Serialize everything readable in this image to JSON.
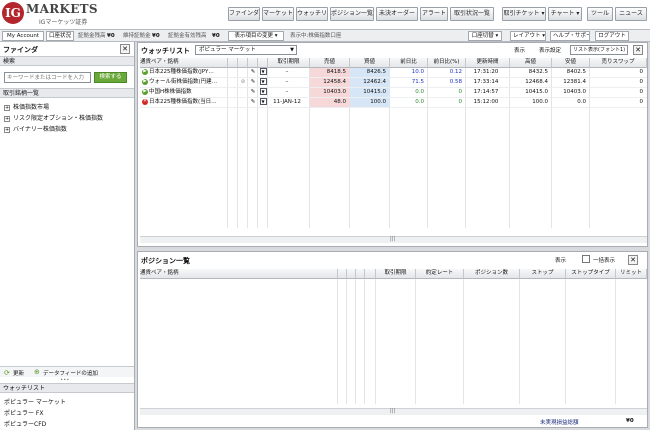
{
  "header": {
    "logo_mark": "IG",
    "logo_text": "MARKETS",
    "logo_subtitle": "IGマーケッツ証券",
    "nav_buttons": [
      "ファインダ",
      "マーケット",
      "ウォッチリスト",
      "ポジション一覧",
      "未決オーダー",
      "アラート",
      "取引状況一覧",
      "取引チケット ▾",
      "チャート ▾",
      "ツール",
      "ニュース"
    ]
  },
  "account_bar": {
    "my_account": "My Account",
    "account_status": "口座状況",
    "deposit_label": "証拠金残高",
    "deposit_value": "¥0",
    "maintenance_label": "維持証拠金",
    "maintenance_value": "¥0",
    "available_label": "証拠金有効残高",
    "available_value": "¥0",
    "display_change": "表示項目の変更 ▾",
    "index_account": "表示中:株価指数口座",
    "switch_account": "口座切替 ▾",
    "layout": "レイアウト ▾",
    "help": "ヘルプ・サポート",
    "logout": "ログアウト"
  },
  "finder": {
    "title": "ファインダ",
    "close": "✕",
    "search_label": "検索",
    "search_placeholder": "キーワードまたはコードを入力",
    "search_button": "検索する",
    "list_label": "取引銘柄一覧",
    "tree": [
      "株価指数市場",
      "リスク限定オプション・株価指数",
      "バイナリー株価指数"
    ],
    "update": "更新",
    "add_feed": "データフィードの追加",
    "watchlist_label": "ウォッチリスト",
    "watchlists": [
      "ポピュラー マーケット",
      "ポピュラー FX",
      "ポピュラーCFD"
    ]
  },
  "watchlist": {
    "title": "ウォッチリスト",
    "selected": "ポピュラー マーケット",
    "display": "表示",
    "display_settings": "表示設定",
    "view_select": "リスト表示(フォント1)",
    "columns": [
      "通貨ペア・銘柄",
      "",
      "",
      "",
      "",
      "取引期限",
      "売値",
      "買値",
      "前日比",
      "前日比(%)",
      "更新時間",
      "高値",
      "安値",
      "売りスワップ"
    ],
    "rows": [
      {
        "status": "open",
        "name": "日本225種株価指数(JPY…",
        "expiry": "–",
        "sell": "8418.5",
        "buy": "8426.5",
        "change": "10.0",
        "change_pct": "0.12",
        "time": "17:31:20",
        "high": "8432.5",
        "low": "8402.5",
        "swap": "0"
      },
      {
        "status": "open",
        "name": "ウォール街株価指数(円建…",
        "expiry": "–",
        "sell": "12458.4",
        "buy": "12462.4",
        "change": "71.5",
        "change_pct": "0.58",
        "time": "17:33:14",
        "high": "12468.4",
        "low": "12381.4",
        "swap": "0"
      },
      {
        "status": "open",
        "name": "中国H株株価指数",
        "expiry": "–",
        "sell": "10403.0",
        "buy": "10415.0",
        "change": "0.0",
        "change_pct": "0",
        "time": "17:14:57",
        "high": "10415.0",
        "low": "10403.0",
        "swap": "0"
      },
      {
        "status": "closed",
        "name": "日本225種株価指数(当日…",
        "expiry": "11-JAN-12",
        "sell": "48.0",
        "buy": "100.0",
        "change": "0.0",
        "change_pct": "0",
        "time": "15:12:00",
        "high": "100.0",
        "low": "0.0",
        "swap": "0"
      }
    ],
    "scroll": "|||"
  },
  "positions": {
    "title": "ポジション一覧",
    "display": "表示",
    "bulk_display": "一括表示",
    "close": "✕",
    "columns": [
      "通貨ペア・銘柄",
      "",
      "",
      "",
      "",
      "取引期限",
      "約定レート",
      "ポジション数",
      "ストップ",
      "ストップタイプ",
      "リミット"
    ],
    "scroll": "|||",
    "footer_label": "未実現損益総額",
    "footer_value": "¥0"
  },
  "colors": {
    "accent": "#b3262d",
    "open": "#5aa02c",
    "closed": "#d02828",
    "sell_bg": "#f6d8d8",
    "buy_bg": "#d6e6f6",
    "positive": "#1a33c8"
  }
}
